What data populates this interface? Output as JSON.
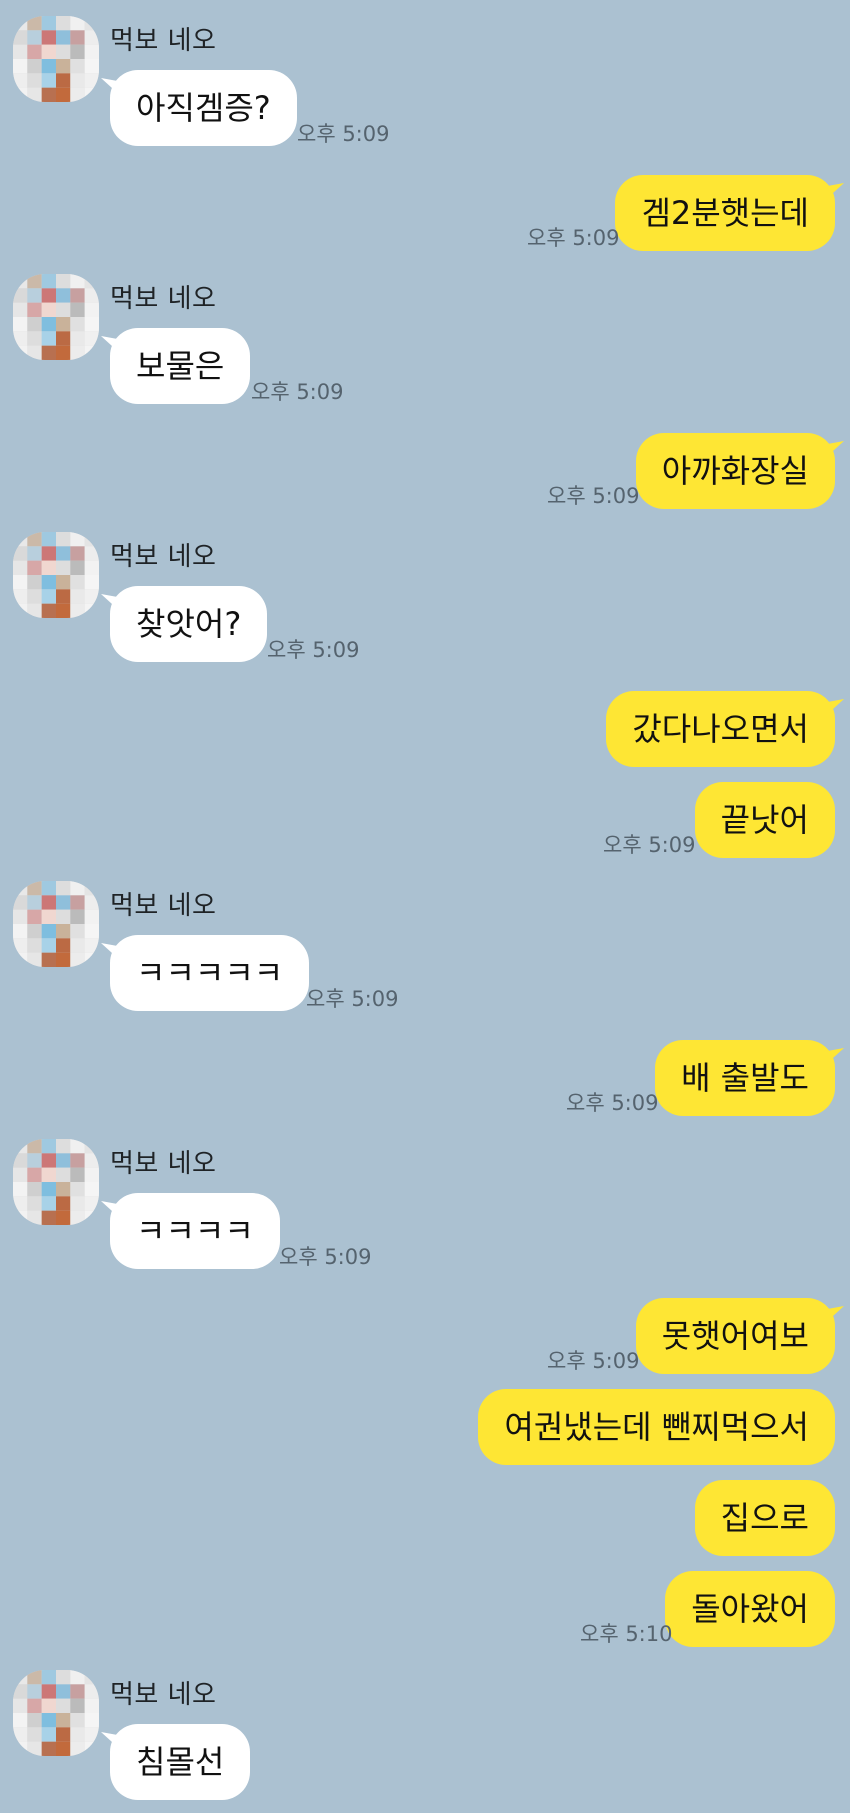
{
  "contact": {
    "name": "먹보 네오"
  },
  "messages": [
    {
      "side": "in",
      "text": "아직겜증?",
      "time": "오후 5:09"
    },
    {
      "side": "out",
      "text": "겜2분햇는데",
      "time": "오후 5:09"
    },
    {
      "side": "in",
      "text": "보물은",
      "time": "오후 5:09"
    },
    {
      "side": "out",
      "text": "아까화장실",
      "time": "오후 5:09"
    },
    {
      "side": "in",
      "text": "찾앗어?",
      "time": "오후 5:09"
    },
    {
      "side": "out",
      "text": "갔다나오면서",
      "time": ""
    },
    {
      "side": "out",
      "text": "끝낫어",
      "time": "오후 5:09"
    },
    {
      "side": "in",
      "text": "ㅋㅋㅋㅋㅋ",
      "time": "오후 5:09"
    },
    {
      "side": "out",
      "text": "배 출발도",
      "time": "오후 5:09"
    },
    {
      "side": "in",
      "text": "ㅋㅋㅋㅋ",
      "time": "오후 5:09"
    },
    {
      "side": "out",
      "text": "못햇어여보",
      "time": "오후 5:09"
    },
    {
      "side": "out",
      "text": "여권냈는데 뺀찌먹으서",
      "time": ""
    },
    {
      "side": "out",
      "text": "집으로",
      "time": ""
    },
    {
      "side": "out",
      "text": "돌아왔어",
      "time": "오후 5:10"
    },
    {
      "side": "in",
      "text": "침몰선",
      "time": ""
    }
  ],
  "colors": {
    "background": "#abc1d1",
    "incoming_bubble": "#ffffff",
    "outgoing_bubble": "#fee634",
    "timestamp": "#55636e"
  },
  "icons": {
    "avatar": "pixelated-profile-avatar"
  }
}
